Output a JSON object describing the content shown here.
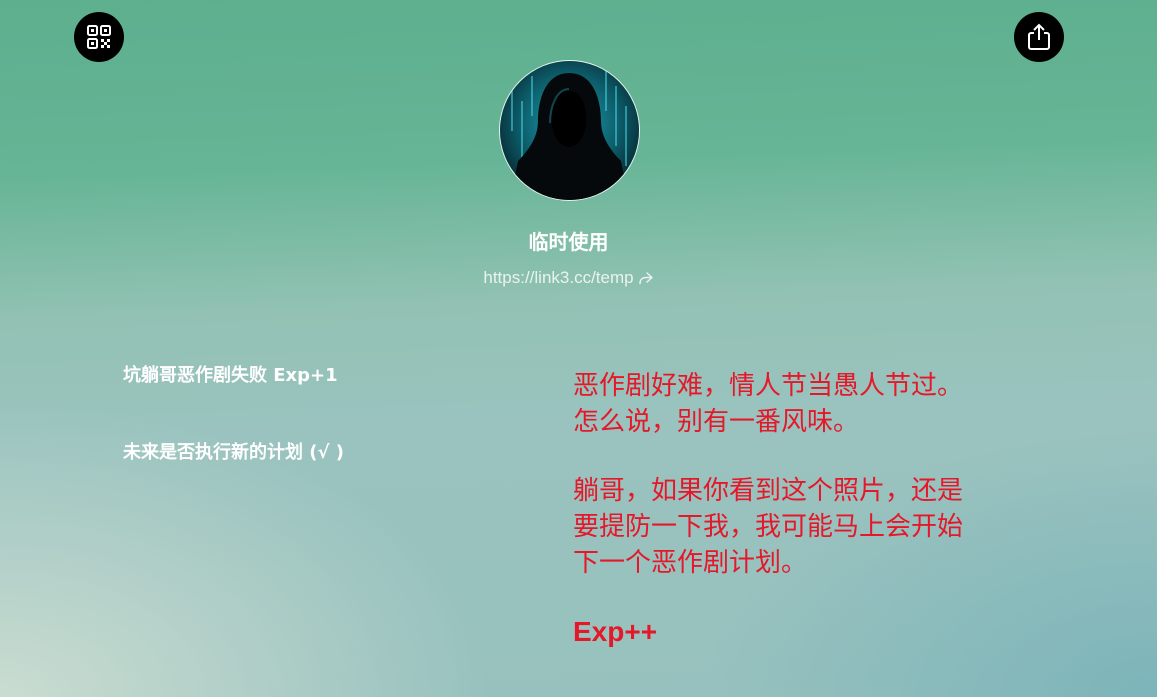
{
  "header": {
    "qr_icon": "qr-code-icon",
    "share_icon": "share-icon"
  },
  "profile": {
    "name": "临时使用",
    "link": "https://link3.cc/temp",
    "link_icon": "share-arrow-icon",
    "avatar": "hooded-figure-avatar"
  },
  "left_notes": [
    "坑躺哥恶作剧失败 Exp+1",
    "未来是否执行新的计划 (√ )"
  ],
  "right_text": {
    "paragraph1": [
      "恶作剧好难，情人节当愚人节过。",
      "怎么说，别有一番风味。"
    ],
    "paragraph2": [
      "躺哥，如果你看到这个照片，还是",
      "要提防一下我，我可能马上会开始",
      "下一个恶作剧计划。"
    ],
    "footer": "Exp++"
  },
  "colors": {
    "accent_red": "#e5182a",
    "button_bg": "#000000",
    "text_white": "#ffffff"
  }
}
